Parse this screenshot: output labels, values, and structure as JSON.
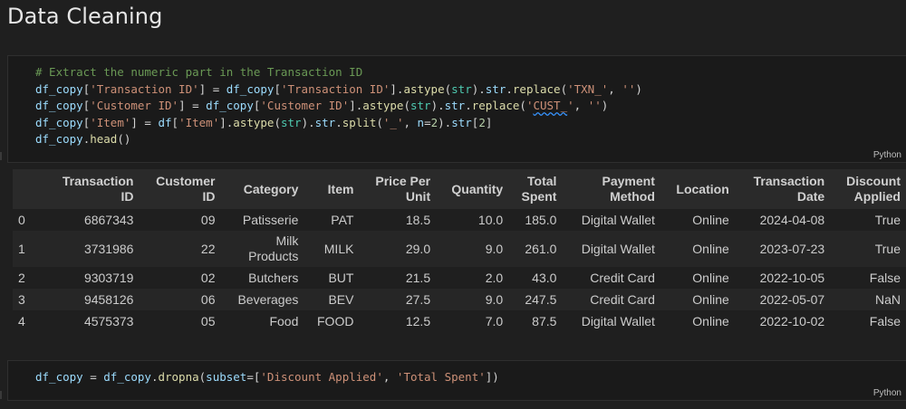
{
  "heading": "Data Cleaning",
  "cell1": {
    "language": "Python",
    "comment": "# Extract the numeric part in the Transaction ID",
    "df_copy": "df_copy",
    "df": "df",
    "col_txn": "'Transaction ID'",
    "col_cust": "'Customer ID'",
    "col_item": "'Item'",
    "astype": "astype",
    "str_type": "str",
    "replace": "replace",
    "split": "split",
    "head": "head",
    "str_txn": "'TXN_'",
    "str_cust_a": "'",
    "str_cust_b": "CUST_",
    "str_cust_c": "'",
    "str_empty": "''",
    "str_underscore": "'_'",
    "n_param": "n",
    "num2": "2"
  },
  "cell2": {
    "language": "Python",
    "df_copy": "df_copy",
    "dropna": "dropna",
    "subset": "subset",
    "col_discount": "'Discount Applied'",
    "col_total": "'Total Spent'"
  },
  "table": {
    "headers": [
      {
        "line1": "",
        "line2": ""
      },
      {
        "line1": "Transaction",
        "line2": "ID"
      },
      {
        "line1": "Customer",
        "line2": "ID"
      },
      {
        "line1": "Category",
        "line2": ""
      },
      {
        "line1": "Item",
        "line2": ""
      },
      {
        "line1": "Price Per",
        "line2": "Unit"
      },
      {
        "line1": "Quantity",
        "line2": ""
      },
      {
        "line1": "Total",
        "line2": "Spent"
      },
      {
        "line1": "Payment",
        "line2": "Method"
      },
      {
        "line1": "Location",
        "line2": ""
      },
      {
        "line1": "Transaction",
        "line2": "Date"
      },
      {
        "line1": "Discount",
        "line2": "Applied"
      }
    ],
    "rows": [
      {
        "idx": "0",
        "txn": "6867343",
        "cust": "09",
        "cat1": "Patisserie",
        "cat2": "",
        "item": "PAT",
        "price": "18.5",
        "qty": "10.0",
        "total": "185.0",
        "pay": "Digital Wallet",
        "loc": "Online",
        "date": "2024-04-08",
        "disc": "True"
      },
      {
        "idx": "1",
        "txn": "3731986",
        "cust": "22",
        "cat1": "Milk",
        "cat2": "Products",
        "item": "MILK",
        "price": "29.0",
        "qty": "9.0",
        "total": "261.0",
        "pay": "Digital Wallet",
        "loc": "Online",
        "date": "2023-07-23",
        "disc": "True"
      },
      {
        "idx": "2",
        "txn": "9303719",
        "cust": "02",
        "cat1": "Butchers",
        "cat2": "",
        "item": "BUT",
        "price": "21.5",
        "qty": "2.0",
        "total": "43.0",
        "pay": "Credit Card",
        "loc": "Online",
        "date": "2022-10-05",
        "disc": "False"
      },
      {
        "idx": "3",
        "txn": "9458126",
        "cust": "06",
        "cat1": "Beverages",
        "cat2": "",
        "item": "BEV",
        "price": "27.5",
        "qty": "9.0",
        "total": "247.5",
        "pay": "Credit Card",
        "loc": "Online",
        "date": "2022-05-07",
        "disc": "NaN"
      },
      {
        "idx": "4",
        "txn": "4575373",
        "cust": "05",
        "cat1": "Food",
        "cat2": "",
        "item": "FOOD",
        "price": "12.5",
        "qty": "7.0",
        "total": "87.5",
        "pay": "Digital Wallet",
        "loc": "Online",
        "date": "2022-10-02",
        "disc": "False"
      }
    ]
  }
}
